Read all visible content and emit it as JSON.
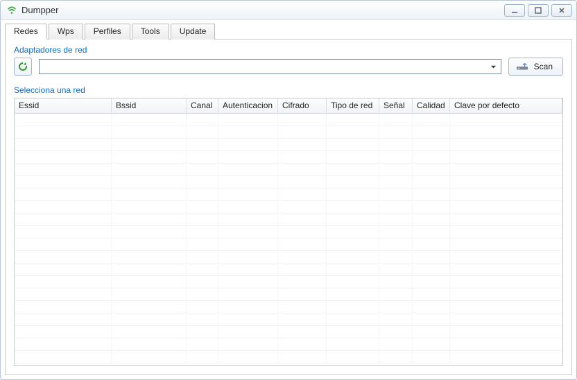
{
  "window": {
    "title": "Dumpper"
  },
  "tabs": [
    {
      "label": "Redes",
      "active": true
    },
    {
      "label": "Wps",
      "active": false
    },
    {
      "label": "Perfiles",
      "active": false
    },
    {
      "label": "Tools",
      "active": false
    },
    {
      "label": "Update",
      "active": false
    }
  ],
  "sections": {
    "adapters_label": "Adaptadores de red",
    "select_network_label": "Selecciona una red"
  },
  "adapter": {
    "selected": ""
  },
  "scan": {
    "label": "Scan"
  },
  "columns": [
    "Essid",
    "Bssid",
    "Canal",
    "Autenticacion",
    "Cifrado",
    "Tipo de red",
    "Señal",
    "Calidad",
    "Clave por defecto"
  ],
  "rows": [],
  "icons": {
    "app": "wifi-icon",
    "refresh": "refresh-icon",
    "scan": "router-icon",
    "dropdown": "chevron-down-icon"
  }
}
